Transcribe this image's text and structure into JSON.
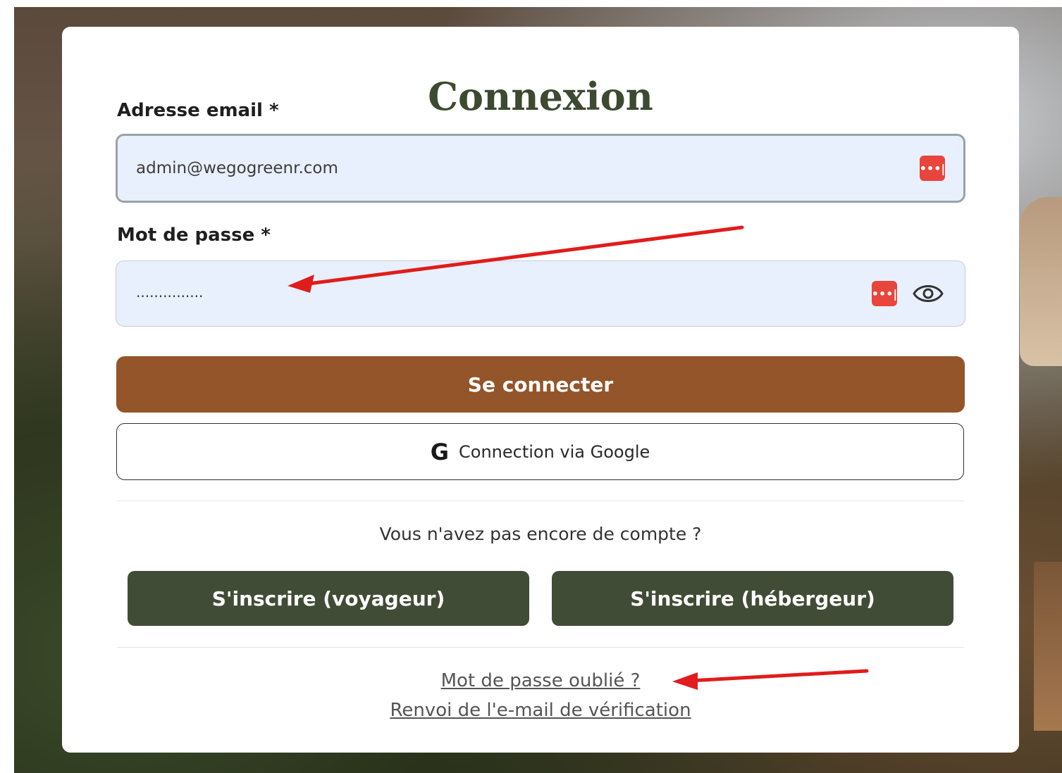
{
  "login": {
    "title": "Connexion",
    "email_label": "Adresse email *",
    "email_value": "admin@wegogreenr.com",
    "password_label": "Mot de passe *",
    "password_masked": "...............",
    "password_manager_glyph": "•••|",
    "submit_label": "Se connecter",
    "google_glyph": "G",
    "google_label": "Connection via Google",
    "no_account_text": "Vous n'avez pas encore de compte ?",
    "signup_traveler_label": "S'inscrire (voyageur)",
    "signup_host_label": "S'inscrire (hébergeur)",
    "forgot_password_link": "Mot de passe oublié ?",
    "resend_verification_link": "Renvoi de l'e-mail de vérification"
  },
  "icons": {
    "password_manager": "password-manager-icon",
    "show_password": "eye-icon",
    "google": "google-icon"
  },
  "colors": {
    "title": "#3d4a31",
    "login_button": "#935529",
    "signup_button": "#414c36",
    "input_background": "#e8f0fe",
    "annotation_arrow": "#e11c1c",
    "password_manager": "#e8453c"
  }
}
